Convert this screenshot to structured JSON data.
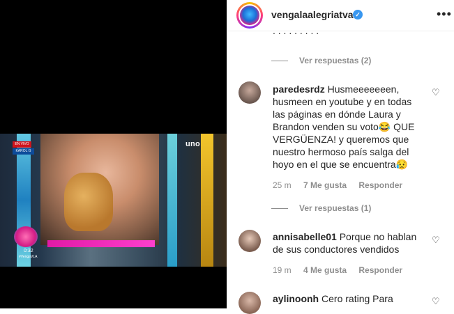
{
  "header": {
    "username": "vengalaalegriatva",
    "verified_icon": "verified-badge-icon",
    "more_icon": "more-options-icon"
  },
  "video": {
    "onair_label": "EN VIVO",
    "guest_label": "KAROL G",
    "channel_logo": "uno",
    "clock": "0:32",
    "hashtag": "#VengaVLA"
  },
  "comments": [
    {
      "view_replies": "Ver respuestas (2)"
    },
    {
      "username": "paredesrdz",
      "text": "Husmeeeeeeen, husmeen en youtube y en todas las páginas en dónde Laura y Brandon venden su voto😂 QUE VERGÜENZA! y queremos que nuestro hermoso país salga del hoyo en el que se encuentra😥",
      "time": "25 m",
      "likes": "7 Me gusta",
      "reply": "Responder",
      "view_replies": "Ver respuestas (1)"
    },
    {
      "username": "annisabelle01",
      "text": "Porque no hablan de sus conductores vendidos",
      "time": "19 m",
      "likes": "4 Me gusta",
      "reply": "Responder"
    },
    {
      "username": "aylinoonh",
      "text": "Cero rating Para"
    }
  ],
  "colors": {
    "meta_gray": "#8e8e8e",
    "verified_blue": "#3897f0",
    "text": "#262626"
  }
}
